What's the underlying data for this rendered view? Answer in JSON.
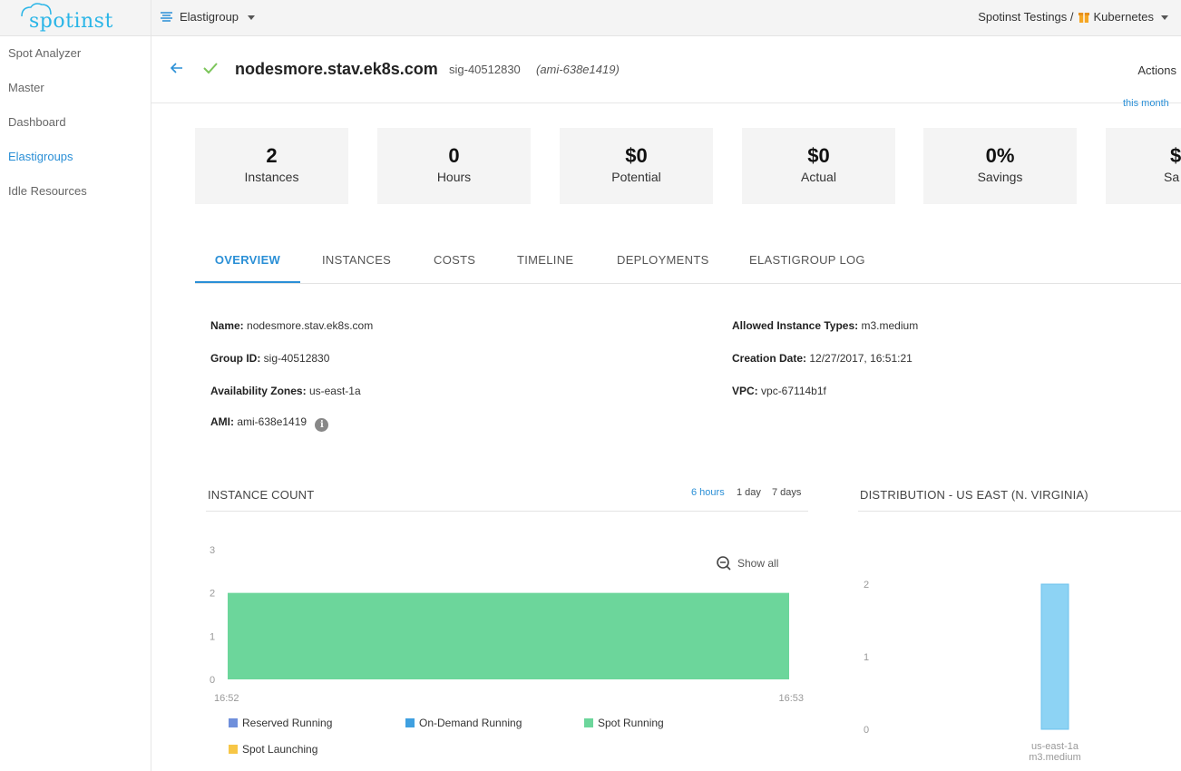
{
  "topbar": {
    "logo_text": "spotinst",
    "product": "Elastigroup",
    "account": "Spotinst Testings /",
    "environment": "Kubernetes"
  },
  "sidebar": {
    "items": [
      {
        "label": "Spot Analyzer",
        "active": false
      },
      {
        "label": "Master",
        "active": false
      },
      {
        "label": "Dashboard",
        "active": false
      },
      {
        "label": "Elastigroups",
        "active": true
      },
      {
        "label": "Idle Resources",
        "active": false
      }
    ]
  },
  "header": {
    "name": "nodesmore.stav.ek8s.com",
    "group_id": "sig-40512830",
    "ami": "(ami-638e1419)",
    "actions_label": "Actions",
    "this_month": "this month"
  },
  "stats": [
    {
      "value": "2",
      "label": "Instances"
    },
    {
      "value": "0",
      "label": "Hours"
    },
    {
      "value": "$0",
      "label": "Potential"
    },
    {
      "value": "$0",
      "label": "Actual"
    },
    {
      "value": "0%",
      "label": "Savings"
    },
    {
      "value": "$",
      "label": "Sa"
    }
  ],
  "tabs": [
    "OVERVIEW",
    "INSTANCES",
    "COSTS",
    "TIMELINE",
    "DEPLOYMENTS",
    "ELASTIGROUP LOG"
  ],
  "details": {
    "name_label": "Name:",
    "name_value": "nodesmore.stav.ek8s.com",
    "group_label": "Group ID:",
    "group_value": "sig-40512830",
    "az_label": "Availability Zones:",
    "az_value": "us-east-1a",
    "ami_label": "AMI:",
    "ami_value": "ami-638e1419",
    "types_label": "Allowed Instance Types:",
    "types_value": "m3.medium",
    "created_label": "Creation Date:",
    "created_value": "12/27/2017, 16:51:21",
    "vpc_label": "VPC:",
    "vpc_value": "vpc-67114b1f"
  },
  "instance_chart": {
    "title": "INSTANCE COUNT",
    "ranges": [
      "6 hours",
      "1 day",
      "7 days"
    ],
    "active_range": "6 hours",
    "show_all": "Show all",
    "legend": [
      {
        "label": "Reserved Running",
        "color": "#6f8fdb"
      },
      {
        "label": "On-Demand Running",
        "color": "#3fa0e0"
      },
      {
        "label": "Spot Running",
        "color": "#6cd69b"
      },
      {
        "label": "Spot Launching",
        "color": "#f7c646"
      }
    ]
  },
  "distribution_chart": {
    "title": "DISTRIBUTION - US EAST (N. VIRGINIA)"
  },
  "chart_data": [
    {
      "type": "area",
      "title": "INSTANCE COUNT",
      "x": [
        "16:52",
        "16:53"
      ],
      "yticks": [
        0,
        1,
        2,
        3
      ],
      "ylim": [
        0,
        3
      ],
      "series": [
        {
          "name": "Spot Running",
          "values": [
            2,
            2
          ],
          "color": "#6cd69b"
        }
      ],
      "legend": "bottom"
    },
    {
      "type": "bar",
      "title": "DISTRIBUTION - US EAST (N. VIRGINIA)",
      "categories": [
        [
          "us-east-1a",
          "m3.medium"
        ]
      ],
      "values": [
        2
      ],
      "yticks": [
        0,
        1,
        2
      ],
      "ylim": [
        0,
        2
      ],
      "color": "#8dd3f4"
    }
  ]
}
